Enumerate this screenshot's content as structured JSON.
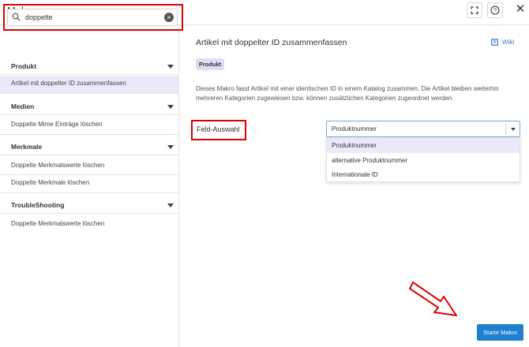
{
  "window": {
    "title": "Makros"
  },
  "header": {
    "icons": [
      "fullscreen-icon",
      "help-icon",
      "close-icon"
    ],
    "close_glyph": "✕",
    "help_glyph": "?"
  },
  "search": {
    "value": "doppelte",
    "clear_glyph": "×"
  },
  "sidebar": {
    "groups": [
      {
        "label": "Produkt",
        "items": [
          "Artikel mit doppelter ID zusammenfassen"
        ]
      },
      {
        "label": "Medien",
        "items": [
          "Doppelte Mime Einträge löschen"
        ]
      },
      {
        "label": "Merkmale",
        "items": [
          "Doppelte Merkmalswerte löschen",
          "Doppelte Merkmale löschen"
        ]
      },
      {
        "label": "TroubleShooting",
        "items": [
          "Doppelte Merkmalswerte löschen"
        ]
      }
    ],
    "selected_item": "Artikel mit doppelter ID zusammenfassen"
  },
  "main": {
    "title": "Artikel mit doppelter ID zusammenfassen",
    "wiki_label": "Wiki",
    "badge": "Produkt",
    "description": "Dieses Makro fasst Artikel mit einer identischen ID in einem Katalog zusammen. Die Artikel bleiben weiterhin mehreren Kategorien zugewiesen bzw. können zusätzlichen Kategorien zugeordnet werden.",
    "field_label": "Feld-Auswahl",
    "select_value": "Produktnummer",
    "options": [
      "Produktnummer",
      "alternative Produktnummer",
      "Internationale ID"
    ],
    "start_label": "Starte Makro"
  },
  "colors": {
    "accent": "#1f7fd1",
    "highlight": "#ebe9f8",
    "annotation": "#e00000"
  }
}
